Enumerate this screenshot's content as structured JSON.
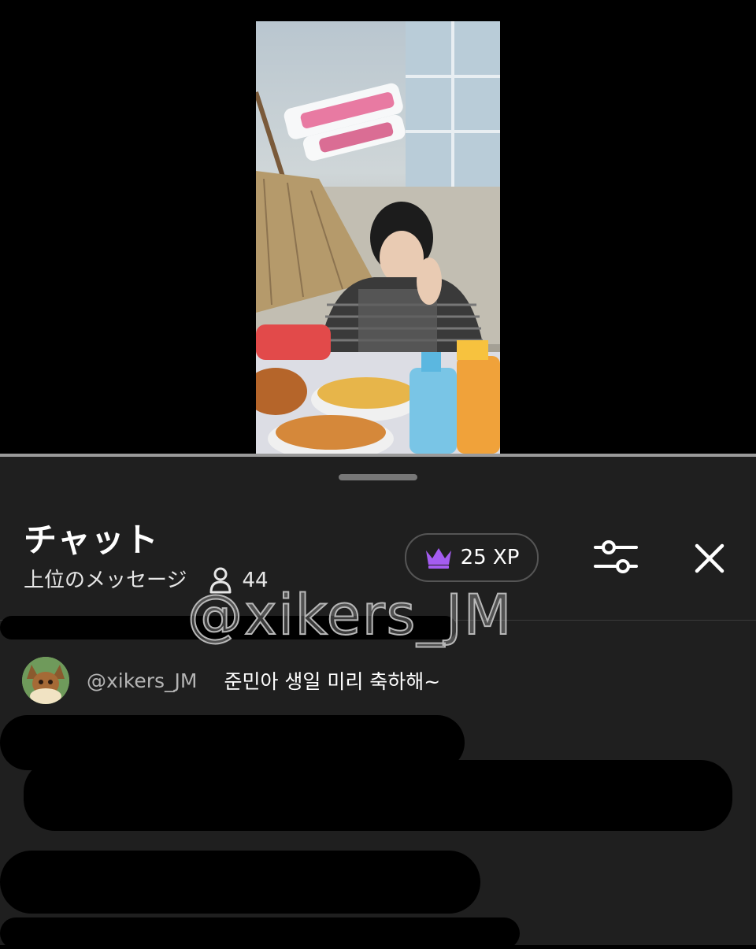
{
  "video": {
    "thumbnail_overlay_text": "",
    "progress_fraction": 0.0
  },
  "chat": {
    "title": "チャット",
    "subtitle": "上位のメッセージ",
    "viewer_count": "44",
    "xp_label": "25 XP"
  },
  "watermark": "@xikers_JM",
  "messages": [
    {
      "author": "@xikers_JM",
      "text": "준민아 생일 미리 축하해~"
    }
  ],
  "colors": {
    "panel_bg": "#1f1f1f",
    "crown": "#a45cf0",
    "progress_played": "#ff0000"
  }
}
